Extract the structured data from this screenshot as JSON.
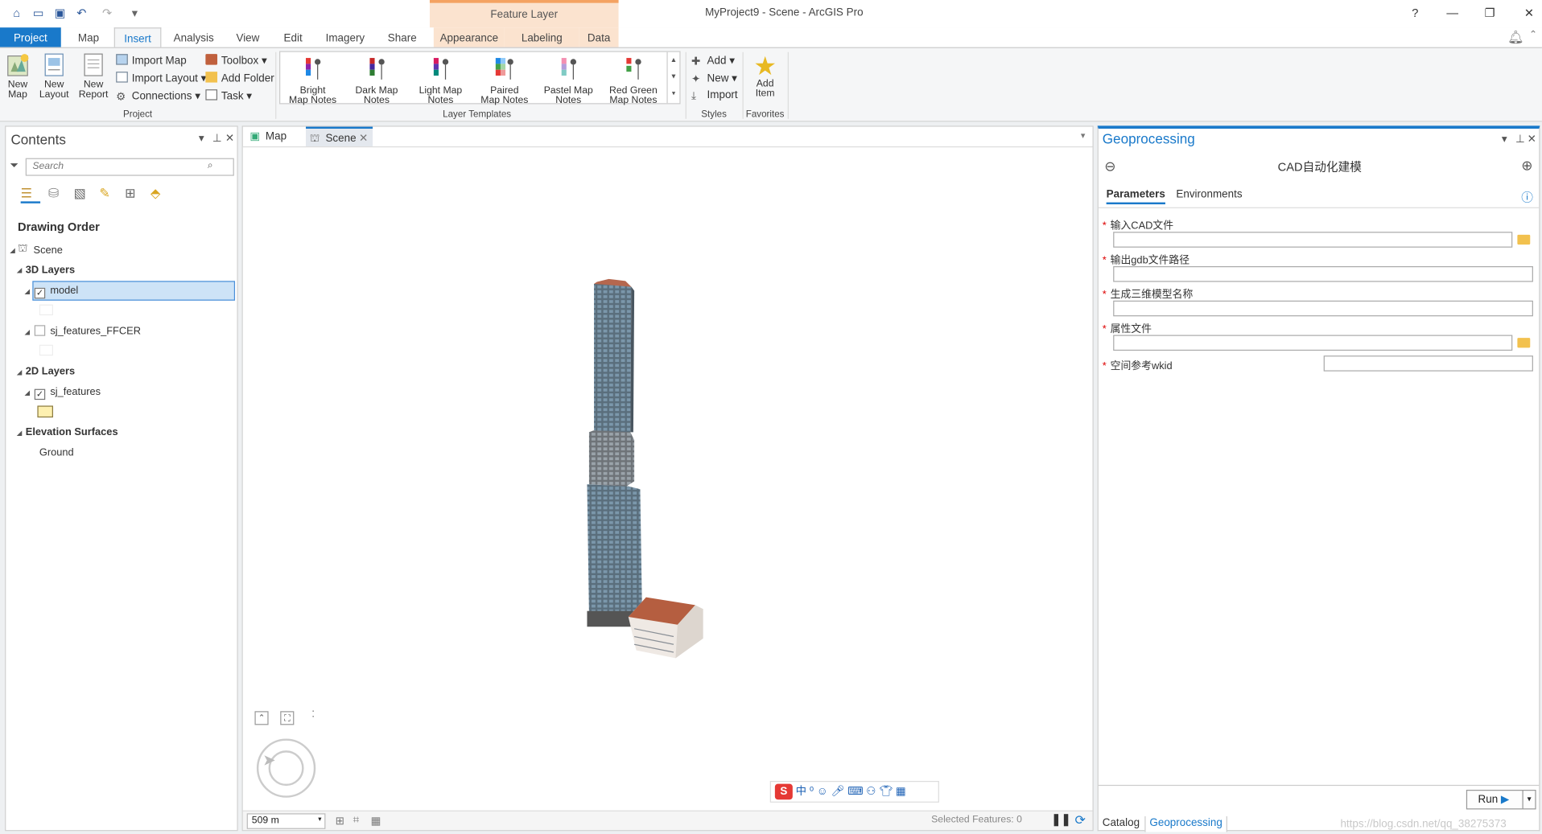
{
  "window": {
    "title": "MyProject9 - Scene - ArcGIS Pro",
    "context_tab": "Feature Layer",
    "help": "?",
    "minimize": "—",
    "restore": "❐",
    "close": "✕"
  },
  "quick_access": {
    "icons": [
      "home-icon",
      "open-icon",
      "save-icon",
      "undo-icon",
      "redo-icon",
      "customize-icon"
    ]
  },
  "ribbon_tabs": [
    "Project",
    "Map",
    "Insert",
    "Analysis",
    "View",
    "Edit",
    "Imagery",
    "Share",
    "Appearance",
    "Labeling",
    "Data"
  ],
  "active_tab": "Insert",
  "ribbon": {
    "project": {
      "new_map": "New\nMap",
      "new_layout": "New\nLayout",
      "new_report": "New\nReport",
      "import_map": "Import Map",
      "import_layout": "Import Layout",
      "connections": "Connections",
      "toolbox": "Toolbox",
      "add_folder": "Add Folder",
      "task": "Task",
      "group": "Project"
    },
    "templates": [
      "Bright\nMap Notes",
      "Dark Map\nNotes",
      "Light Map\nNotes",
      "Paired\nMap Notes",
      "Pastel Map\nNotes",
      "Red Green\nMap Notes"
    ],
    "templates_group": "Layer Templates",
    "styles": {
      "add": "Add",
      "new": "New",
      "import": "Import",
      "group": "Styles"
    },
    "favorites": {
      "add_item": "Add\nItem",
      "group": "Favorites"
    }
  },
  "contents": {
    "title": "Contents",
    "search_placeholder": "Search",
    "drawing_order": "Drawing Order",
    "scene": "Scene",
    "layers_3d": "3D Layers",
    "model": "model",
    "sj_features_ffcer": "sj_features_FFCER",
    "layers_2d": "2D Layers",
    "sj_features": "sj_features",
    "elevation": "Elevation Surfaces",
    "ground": "Ground"
  },
  "views": {
    "map_tab": "Map",
    "scene_tab": "Scene"
  },
  "status": {
    "scale": "509 m",
    "selected": "Selected Features: 0"
  },
  "geoprocessing": {
    "title": "Geoprocessing",
    "tool_name": "CAD自动化建模",
    "tab_parameters": "Parameters",
    "tab_environments": "Environments",
    "params": [
      "输入CAD文件",
      "输出gdb文件路径",
      "生成三维模型名称",
      "属性文件",
      "空间参考wkid"
    ],
    "run": "Run",
    "bottom_tabs": [
      "Catalog",
      "Geoprocessing"
    ]
  },
  "ime_bar": {
    "label": "中"
  },
  "watermark": "https://blog.csdn.net/qq_38275373"
}
